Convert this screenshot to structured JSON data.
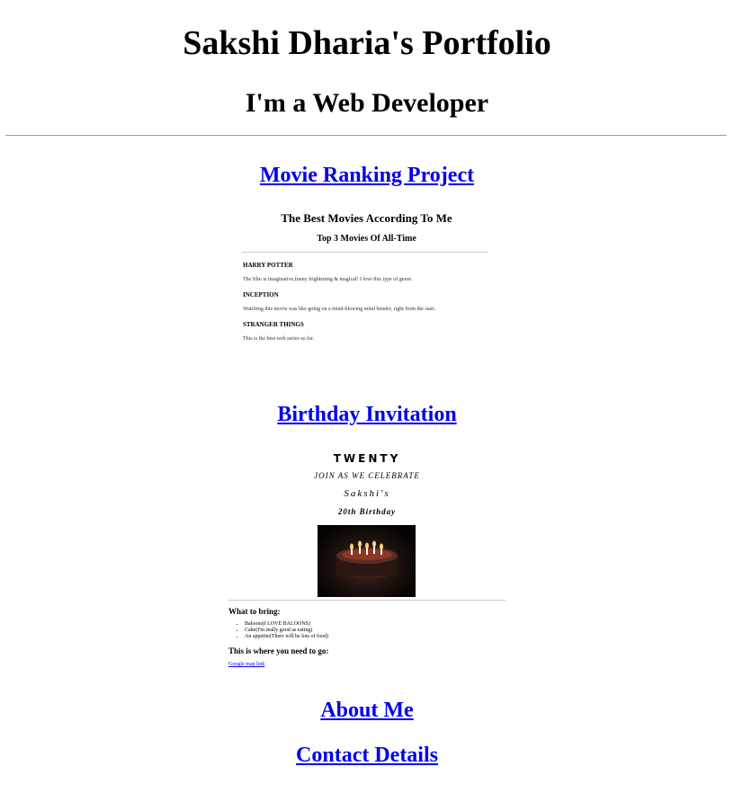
{
  "header": {
    "title": "Sakshi Dharia's Portfolio",
    "subtitle": "I'm a Web Developer"
  },
  "sections": {
    "movie_link": "Movie Ranking Project",
    "birthday_link": "Birthday Invitation",
    "about_link": "About Me",
    "contact_link": "Contact Details"
  },
  "movie_preview": {
    "heading": "The Best Movies According To Me",
    "subheading": "Top 3 Movies Of All-Time",
    "items": [
      {
        "title": "HARRY POTTER",
        "text": "The film is imaginative,funny frightening & magical! I love this type of genre."
      },
      {
        "title": "INCEPTION",
        "text": "Watching this movie was like going on a mind-blowing mind bender, right from the start."
      },
      {
        "title": "STRANGER THINGS",
        "text": "This is the best web series so far."
      }
    ]
  },
  "birthday_preview": {
    "twenty": "TWENTY",
    "join": "JOIN AS WE CELEBRATE",
    "name": "Sakshi's",
    "birthday": "20th Birthday",
    "bring_heading": "What to bring:",
    "bring_items": [
      "Baloons(I LOVE BALOONS)",
      "Cake(I'm really good as eating)",
      "An appetite(There will be lots of food)"
    ],
    "where_heading": "This is where you need to go:",
    "map_link": "Google map link"
  }
}
